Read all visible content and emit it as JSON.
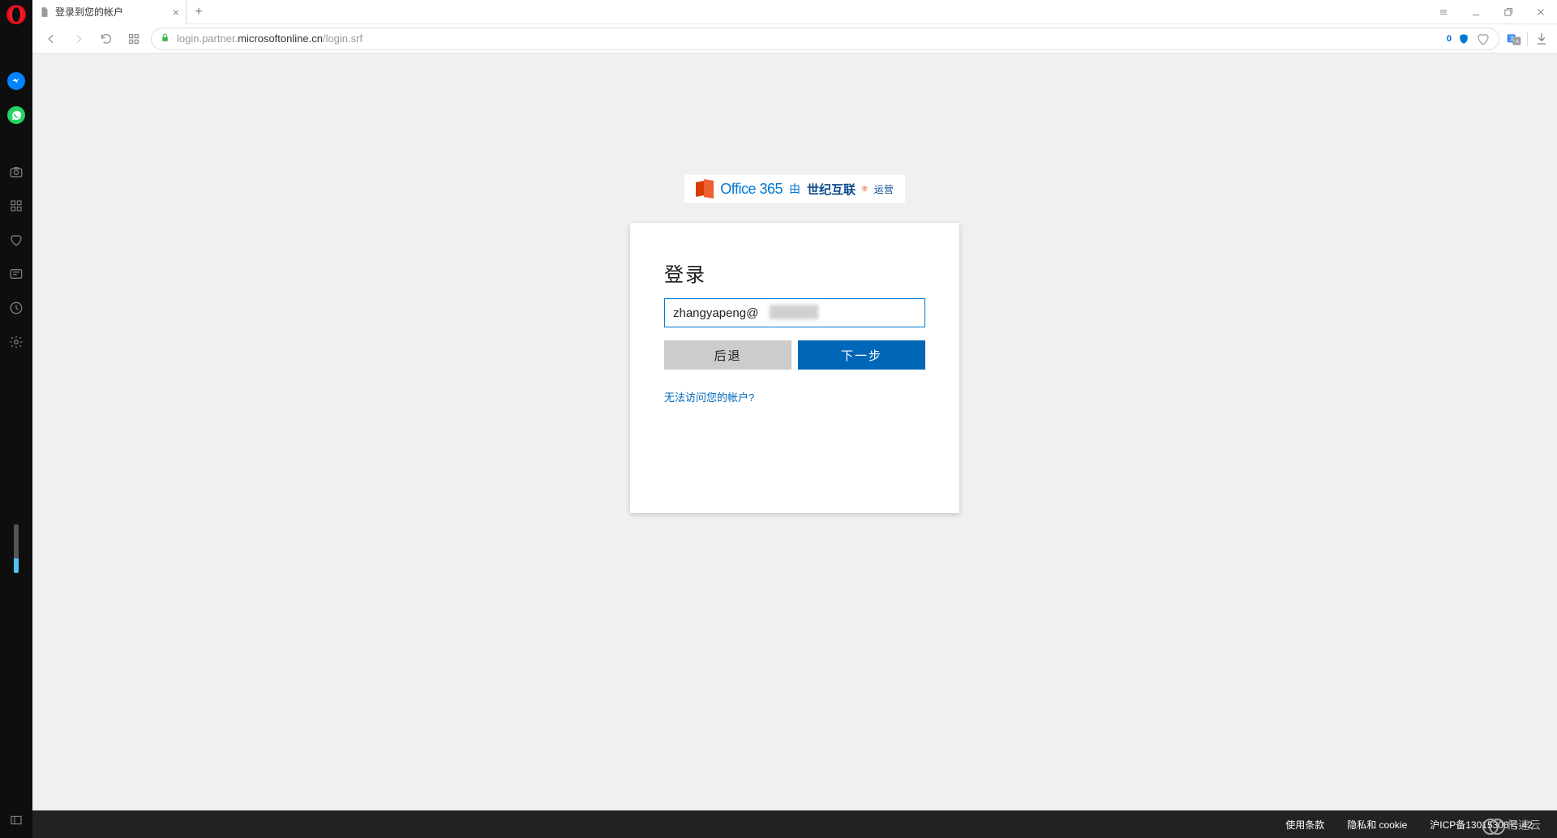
{
  "browser": {
    "tab_title": "登录到您的帐户",
    "url_prefix": "login.partner.",
    "url_host": "microsoftonline.cn",
    "url_path": "/login.srf",
    "blocker_count": "0"
  },
  "sidebar": {
    "icons": [
      "opera",
      "messenger",
      "whatsapp",
      "camera",
      "apps",
      "heart",
      "news",
      "history",
      "settings",
      "panel"
    ]
  },
  "brand": {
    "product": "Office 365",
    "by": "由",
    "operator_cn": "世纪互联",
    "operated": "运营"
  },
  "login": {
    "title": "登录",
    "email_value": "zhangyapeng@",
    "back_label": "后退",
    "next_label": "下一步",
    "help_link": "无法访问您的帐户?"
  },
  "footer": {
    "terms": "使用条款",
    "privacy": "隐私和 cookie",
    "icp": "沪ICP备13015306号-42"
  },
  "watermark": "亿速云"
}
